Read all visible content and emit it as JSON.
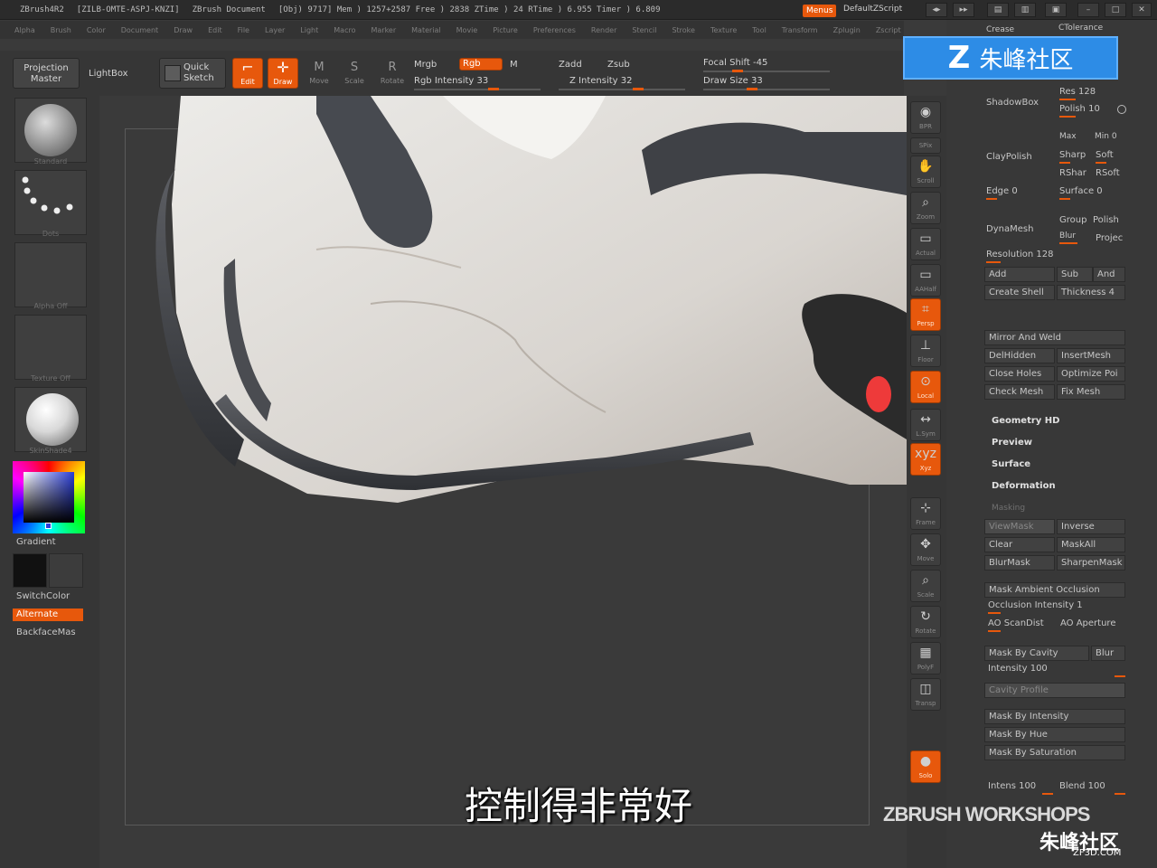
{
  "titlebar": {
    "app": "ZBrush4R2",
    "serial": "[ZILB-OMTE-ASPJ-KNZI]",
    "document": "ZBrush Document",
    "stats": "[Obj) 9717]  Mem ) 1257+2587  Free ) 2838  ZTime ) 24  RTime ) 6.955  Timer ) 6.809",
    "menus": "Menus",
    "script": "DefaultZScript"
  },
  "menubar": [
    "Alpha",
    "Brush",
    "Color",
    "Document",
    "Draw",
    "Edit",
    "File",
    "Layer",
    "Light",
    "Macro",
    "Marker",
    "Material",
    "Movie",
    "Picture",
    "Preferences",
    "Render",
    "Stencil",
    "Stroke",
    "Texture",
    "Tool",
    "Transform",
    "Zplugin",
    "Zscript"
  ],
  "toolbar": {
    "projection_master": "Projection Master",
    "lightbox": "LightBox",
    "quick_sketch": "Quick Sketch",
    "edit": "Edit",
    "draw": "Draw",
    "move": "Move",
    "scale": "Scale",
    "rotate": "Rotate",
    "mrgb": "Mrgb",
    "rgb": "Rgb",
    "m": "M",
    "rgb_intensity": "Rgb Intensity 33",
    "zadd": "Zadd",
    "zsub": "Zsub",
    "z_intensity": "Z Intensity 32",
    "focal_shift": "Focal Shift -45",
    "draw_size": "Draw Size 33"
  },
  "left": {
    "thumbs": [
      "Standard",
      "Dots",
      "Alpha Off",
      "Texture Off",
      "SkinShade4"
    ],
    "gradient": "Gradient",
    "switchcolor": "SwitchColor",
    "alternate": "Alternate",
    "backfacemask": "BackfaceMas"
  },
  "shelf": [
    {
      "icon": "◉",
      "label": "BPR"
    },
    {
      "icon": "▦",
      "label": "SPix"
    },
    {
      "icon": "✋",
      "label": "Scroll"
    },
    {
      "icon": "⌕",
      "label": "Zoom"
    },
    {
      "icon": "▭",
      "label": "Actual"
    },
    {
      "icon": "▭",
      "label": "AAHalf"
    },
    {
      "icon": "⌗",
      "label": "Persp"
    },
    {
      "icon": "⊥",
      "label": "Floor"
    },
    {
      "icon": "⊙",
      "label": "Local"
    },
    {
      "icon": "↔",
      "label": "L.Sym"
    },
    {
      "icon": "xyz",
      "label": "Xyz"
    },
    {
      "icon": "⊹",
      "label": "Frame"
    },
    {
      "icon": "✥",
      "label": "Move"
    },
    {
      "icon": "⌕",
      "label": "Scale"
    },
    {
      "icon": "↻",
      "label": "Rotate"
    },
    {
      "icon": "▦",
      "label": "PolyF"
    },
    {
      "icon": "◫",
      "label": "Transp"
    },
    {
      "icon": "●",
      "label": "Solo"
    }
  ],
  "right": {
    "crease": "Crease",
    "ctolerance": "CTolerance",
    "shadowbox": "ShadowBox",
    "res": "Res 128",
    "polish": "Polish 10",
    "claypolish": "ClayPolish",
    "max": "Max",
    "min": "Min 0",
    "sharp": "Sharp",
    "soft": "Soft",
    "rsharp": "RShar",
    "rsoft": "RSoft",
    "edge": "Edge 0",
    "surface": "Surface 0",
    "dynamesh": "DynaMesh",
    "group": "Group",
    "polish2": "Polish",
    "blur": "Blur",
    "project": "Projec",
    "resolution": "Resolution 128",
    "add": "Add",
    "sub": "Sub",
    "and": "And",
    "create_shell": "Create Shell",
    "thickness": "Thickness 4",
    "mirror_weld": "Mirror And Weld",
    "delhidden": "DelHidden",
    "insertmesh": "InsertMesh",
    "close_holes": "Close Holes",
    "optimize": "Optimize Poi",
    "check_mesh": "Check Mesh",
    "fix_mesh": "Fix Mesh",
    "geometry_hd": "Geometry HD",
    "preview": "Preview",
    "surface_sec": "Surface",
    "deformation": "Deformation",
    "masking": "Masking",
    "viewmask": "ViewMask",
    "inverse": "Inverse",
    "clear": "Clear",
    "maskall": "MaskAll",
    "blurmask": "BlurMask",
    "sharpenmask": "SharpenMask",
    "mask_ao": "Mask Ambient Occlusion",
    "occlusion_intensity": "Occlusion Intensity 1",
    "ao_scandist": "AO ScanDist",
    "ao_aperture": "AO Aperture",
    "mask_by_cavity": "Mask By Cavity",
    "cavity_blur": "Blur",
    "intensity": "Intensity 100",
    "cavity_profile": "Cavity Profile",
    "mask_by_intensity": "Mask By Intensity",
    "mask_by_hue": "Mask By Hue",
    "mask_by_saturation": "Mask By Saturation",
    "intens": "Intens 100",
    "blend": "Blend 100"
  },
  "overlay": {
    "logo_text": "朱峰社区",
    "subtitle": "控制得非常好",
    "watermark": "ZBRUSH WORKSHOPS",
    "wm2": "朱峰社区",
    "wm2_url": "ZF3D.COM"
  },
  "colors": {
    "accent": "#e7580c",
    "logo_blue": "#2d8ce6"
  }
}
